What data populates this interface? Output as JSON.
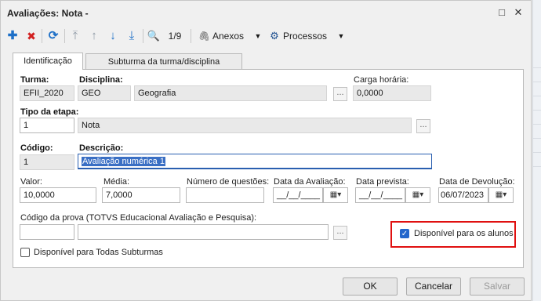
{
  "window": {
    "title": "Avaliações: Nota -",
    "buttons": {
      "restore": "□",
      "close": "✕"
    }
  },
  "toolbar": {
    "add": "✚",
    "delete": "✖",
    "refresh": "⟳",
    "first": "⤒",
    "prev": "↑",
    "next": "↓",
    "last": "⤓",
    "search": "🔍",
    "record_counter": "1/9",
    "attachments_label": "Anexos",
    "processes_label": "Processos",
    "dropdown_arrow": "▼",
    "attach_glyph": "🖇",
    "gear_glyph": "⚙"
  },
  "tabs": [
    {
      "label": "Identificação",
      "active": true
    },
    {
      "label": "Subturma da turma/disciplina",
      "active": false
    }
  ],
  "form": {
    "turma": {
      "label": "Turma:",
      "value": "EFII_2020"
    },
    "disciplina": {
      "label": "Disciplina:",
      "code": "GEO",
      "name": "Geografia"
    },
    "carga_horaria": {
      "label": "Carga horária:",
      "value": "0,0000"
    },
    "tipo_etapa": {
      "label": "Tipo da etapa:",
      "code": "1",
      "name": "Nota"
    },
    "codigo": {
      "label": "Código:",
      "value": "1"
    },
    "descricao": {
      "label": "Descrição:",
      "value": "Avaliação numérica 1"
    },
    "valor": {
      "label": "Valor:",
      "value": "10,0000"
    },
    "media": {
      "label": "Média:",
      "value": "7,0000"
    },
    "num_questoes": {
      "label": "Número de questões:",
      "value": ""
    },
    "data_avaliacao": {
      "label": "Data da Avaliação:",
      "value": "__/__/____"
    },
    "data_prevista": {
      "label": "Data prevista:",
      "value": "__/__/____"
    },
    "data_devolucao": {
      "label": "Data de Devolução:",
      "value": "06/07/2023"
    },
    "codigo_prova": {
      "label": "Código da prova (TOTVS Educacional Avaliação e Pesquisa):",
      "code": "",
      "name": ""
    },
    "disponivel_alunos": {
      "label": "Disponível para os alunos",
      "checked": true
    },
    "disponivel_subturmas": {
      "label": "Disponível para Todas Subturmas",
      "checked": false
    },
    "ellipsis": "...",
    "calendar_glyph": "▦▾",
    "check_glyph": "✓"
  },
  "footer": {
    "ok": "OK",
    "cancel": "Cancelar",
    "save": "Salvar"
  },
  "colors": {
    "accent": "#2266cc",
    "add_icon": "#1d6fc7",
    "delete_icon": "#d22020",
    "highlight_box": "#e01010",
    "selection": "#3a6fc4"
  }
}
